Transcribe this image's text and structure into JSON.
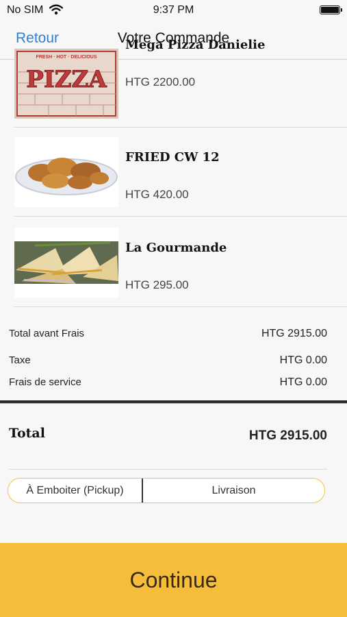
{
  "status_bar": {
    "carrier": "No SIM",
    "time": "9:37 PM"
  },
  "nav": {
    "back_label": "Retour",
    "title": "Votre Commande"
  },
  "items": [
    {
      "name": "Mega Pizza Danielie",
      "price": "HTG 2200.00",
      "thumbnail_text": "PIZZA",
      "thumbnail_tagline": "FRESH · HOT · DELICIOUS"
    },
    {
      "name": "FRIED CW  12",
      "price": "HTG 420.00"
    },
    {
      "name": "La Gourmande",
      "price": "HTG 295.00"
    }
  ],
  "summary": {
    "subtotal_label": "Total avant Frais",
    "subtotal_value": "HTG 2915.00",
    "tax_label": "Taxe",
    "tax_value": "HTG 0.00",
    "fee_label": "Frais de service",
    "fee_value": "HTG 0.00",
    "total_label": "Total",
    "total_value": "HTG 2915.00"
  },
  "delivery_options": {
    "pickup_label": "À Emboiter (Pickup)",
    "delivery_label": "Livraison"
  },
  "continue_label": "Continue",
  "colors": {
    "accent": "#f6bd3a",
    "link": "#2f7fd6",
    "segment_border": "#f2c14a"
  }
}
